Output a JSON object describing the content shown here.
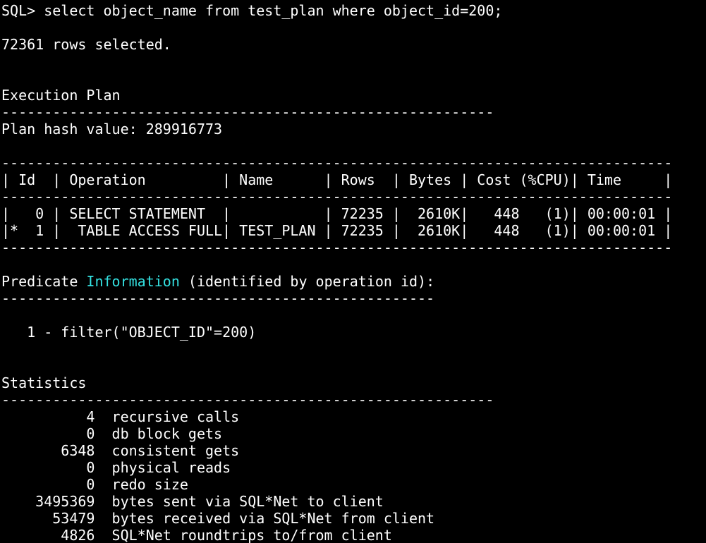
{
  "terminal": {
    "lines": [
      "SQL> select object_name from test_plan where object_id=200;",
      "",
      "72361 rows selected.",
      "",
      "",
      "Execution Plan",
      "----------------------------------------------------------",
      "Plan hash value: 289916773",
      "",
      "-------------------------------------------------------------------------------",
      "| Id  | Operation         | Name      | Rows  | Bytes | Cost (%CPU)| Time     |",
      "-------------------------------------------------------------------------------",
      "|   0 | SELECT STATEMENT  |           | 72235 |  2610K|   448   (1)| 00:00:01 |",
      "|*  1 |  TABLE ACCESS FULL| TEST_PLAN | 72235 |  2610K|   448   (1)| 00:00:01 |",
      "-------------------------------------------------------------------------------",
      "",
      "",
      "---------------------------------------------------",
      "",
      "   1 - filter(\"OBJECT_ID\"=200)",
      "",
      "",
      "Statistics",
      "----------------------------------------------------------",
      "          4  recursive calls",
      "          0  db block gets",
      "       6348  consistent gets",
      "          0  physical reads",
      "          0  redo size",
      "    3495369  bytes sent via SQL*Net to client",
      "      53479  bytes received via SQL*Net from client",
      "       4826  SQL*Net roundtrips to/from client"
    ],
    "predicate": {
      "prefix": "Predicate ",
      "highlight": "Information",
      "suffix": " (identified by operation id):"
    },
    "highlight_color": "#34e2e2"
  }
}
